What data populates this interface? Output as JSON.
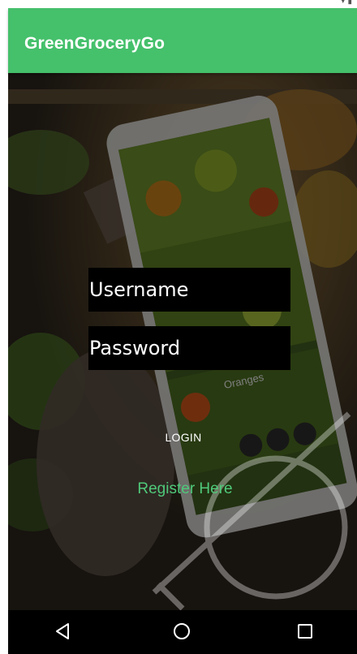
{
  "app": {
    "title": "GreenGroceryGo"
  },
  "login": {
    "username_placeholder": "Username",
    "password_placeholder": "Password",
    "login_label": "LOGIN",
    "register_label": "Register Here"
  },
  "background": {
    "product_label": "Oranges"
  },
  "colors": {
    "app_bar": "#45c06b",
    "register_link": "#4fc97a",
    "input_bg": "#000000",
    "nav_bar": "#000000"
  },
  "nav": {
    "icons": [
      "back-triangle-icon",
      "home-circle-icon",
      "recents-square-icon"
    ]
  }
}
